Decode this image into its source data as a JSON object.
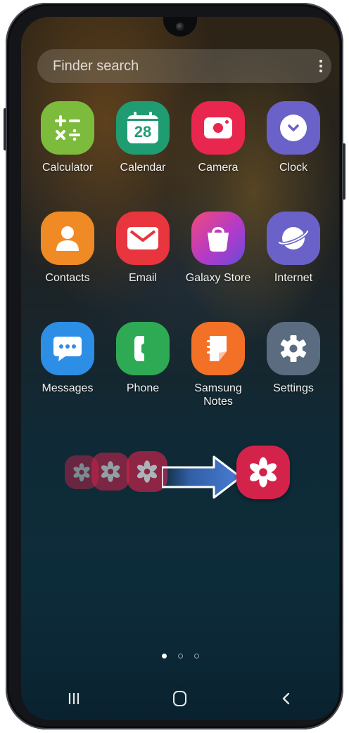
{
  "search": {
    "placeholder": "Finder search"
  },
  "apps": [
    {
      "label": "Calculator",
      "icon": "calculator-icon",
      "color": "#7dbb3c"
    },
    {
      "label": "Calendar",
      "icon": "calendar-icon",
      "color": "#1f9c72",
      "date": "28"
    },
    {
      "label": "Camera",
      "icon": "camera-icon",
      "color": "#e8264e"
    },
    {
      "label": "Clock",
      "icon": "clock-icon",
      "color": "#6a62c8"
    },
    {
      "label": "Contacts",
      "icon": "contact-icon",
      "color": "#f08a24"
    },
    {
      "label": "Email",
      "icon": "email-icon",
      "color": "#e8353e"
    },
    {
      "label": "Galaxy Store",
      "icon": "shopping-bag-icon",
      "color": "#b43ac8"
    },
    {
      "label": "Internet",
      "icon": "planet-icon",
      "color": "#6a62c8"
    },
    {
      "label": "Messages",
      "icon": "chat-bubble-icon",
      "color": "#2d8ee6"
    },
    {
      "label": "Phone",
      "icon": "phone-icon",
      "color": "#2faa54"
    },
    {
      "label": "Samsung Notes",
      "icon": "notes-icon",
      "color": "#f27126"
    },
    {
      "label": "Settings",
      "icon": "gear-icon",
      "color": "#5b6b80"
    }
  ],
  "drag_demo": {
    "icon": "flower-icon",
    "color": "#d4234b",
    "arrow_color": "#3a6bc0"
  },
  "page_indicator": {
    "count": 3,
    "active": 1
  },
  "nav": {
    "recents": "recents-icon",
    "home": "home-icon",
    "back": "back-icon"
  }
}
